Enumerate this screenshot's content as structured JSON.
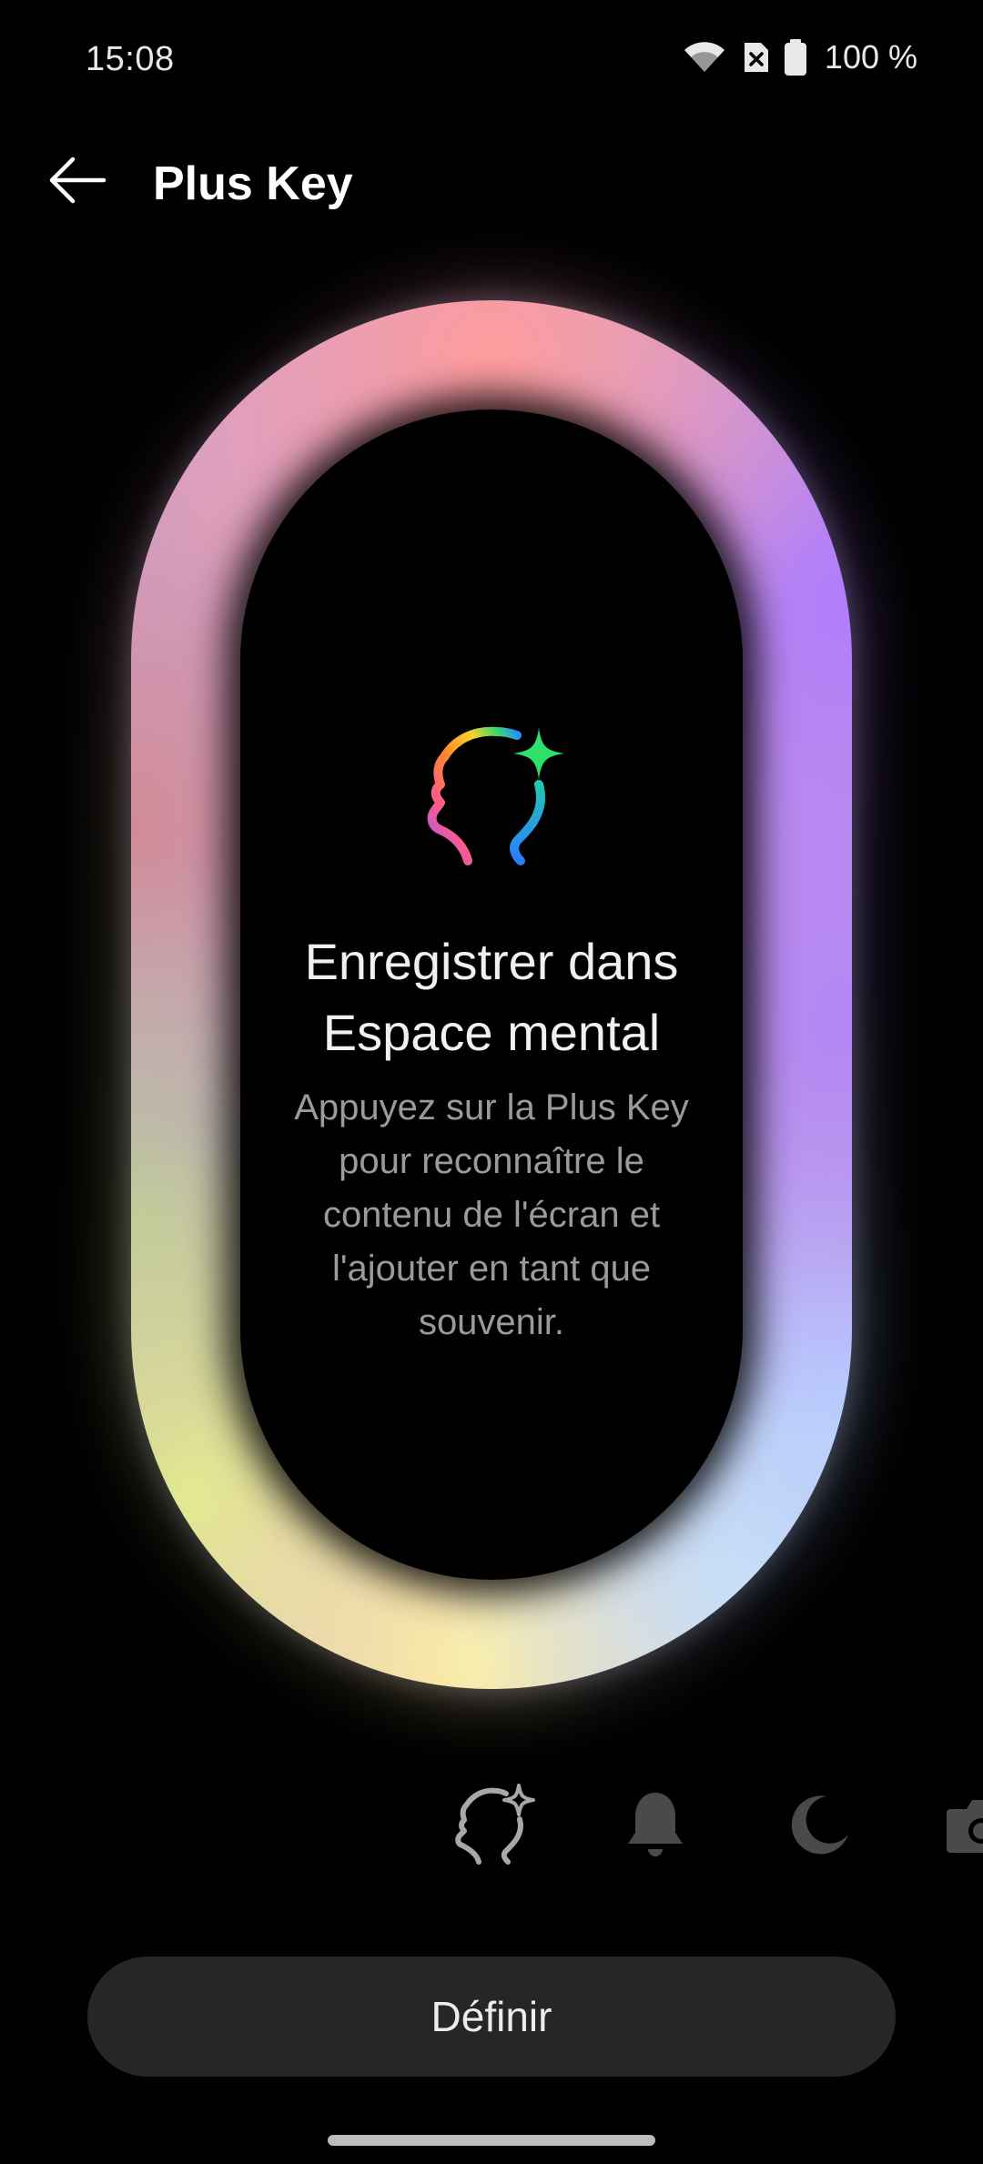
{
  "status_bar": {
    "time": "15:08",
    "battery_text": "100 %",
    "icons": [
      "wifi-icon",
      "no-sim-icon",
      "battery-icon"
    ]
  },
  "header": {
    "title": "Plus Key",
    "back_icon": "arrow-left-icon"
  },
  "feature": {
    "icon": "mind-space-icon",
    "title_line1": "Enregistrer dans",
    "title_line2": "Espace mental",
    "description": "Appuyez sur la Plus Key pour reconnaître le contenu de l'écran et l'ajouter en tant que souvenir."
  },
  "modes": [
    {
      "icon": "mind-space-icon",
      "selected": true
    },
    {
      "icon": "bell-icon",
      "selected": false
    },
    {
      "icon": "moon-icon",
      "selected": false
    },
    {
      "icon": "camera-icon",
      "selected": false
    }
  ],
  "set_button": {
    "label": "Définir"
  },
  "colors": {
    "background": "#000000",
    "button_bg": "#262626",
    "muted_text": "#9a9a9a",
    "ring_top": "#ff9c9c",
    "ring_right": "#b27cfa",
    "ring_bottom": "#fff0a0",
    "ring_left": "#d08c95"
  }
}
